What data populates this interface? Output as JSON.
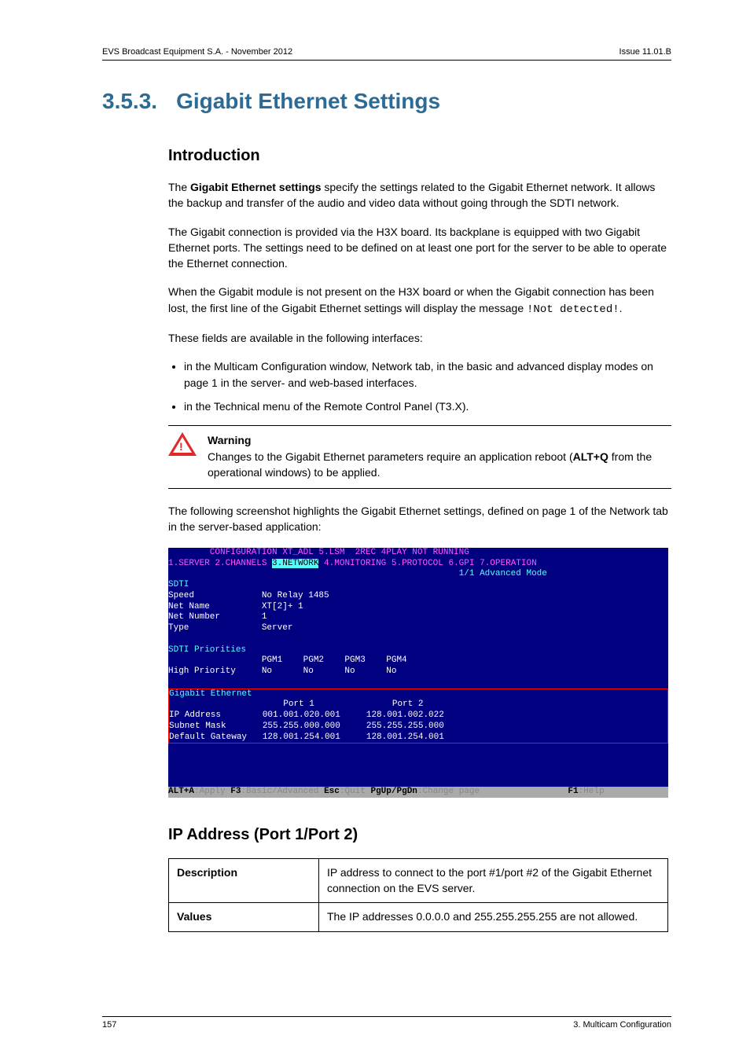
{
  "header": {
    "left": "EVS Broadcast Equipment S.A. - November 2012",
    "right": "Issue 11.01.B"
  },
  "section": {
    "number": "3.5.3.",
    "title": "Gigabit Ethernet Settings"
  },
  "intro": {
    "heading": "Introduction",
    "p1a": "The ",
    "p1b": "Gigabit Ethernet settings",
    "p1c": " specify the settings related to the Gigabit Ethernet network. It allows the backup and transfer of the audio and video data without going through the SDTI network.",
    "p2": "The Gigabit connection is provided via the H3X  board. Its backplane is equipped with two Gigabit Ethernet ports. The settings need to be defined on at least one port for the server to be able to operate the Ethernet connection.",
    "p3a": "When the Gigabit module is not present on the H3X  board or when the Gigabit connection has been lost, the first line of the Gigabit Ethernet settings will display the message ",
    "p3b": "!Not detected!",
    "p3c": ".",
    "p4": "These fields are available in the following interfaces:",
    "li1": "in the Multicam Configuration window, Network tab, in the basic and advanced display modes on page 1 in the server- and web-based interfaces.",
    "li2": "in the Technical menu of the Remote Control Panel (T3.X)."
  },
  "warning": {
    "label": "Warning",
    "text1": "Changes to the Gigabit Ethernet parameters require an application reboot (",
    "bold": "ALT+Q",
    "text2": " from the operational windows) to be applied."
  },
  "beforeShot": "The following screenshot highlights the Gigabit Ethernet settings, defined on page 1 of the Network tab in the server-based application:",
  "dos": {
    "title": "        CONFIGURATION XT_ADL 5.LSM  2REC 4PLAY NOT RUNNING",
    "tabs_left": "1.SERVER 2.CHANNELS ",
    "tabs_sel": "3.NETWORK",
    "tabs_right": " 4.MONITORING 5.PROTOCOL 6.GPI 7.OPERATION",
    "mode": "                                                        1/1 Advanced Mode",
    "sdti_title": "SDTI",
    "speed": "Speed             No Relay 1485",
    "netname": "Net Name          XT[2]+ 1",
    "netnum": "Net Number        1",
    "type": "Type              Server",
    "prio_title": "SDTI Priorities",
    "prio_hdr": "                  PGM1    PGM2    PGM3    PGM4",
    "prio_val": "High Priority     No      No      No      No",
    "ge_title": "Gigabit Ethernet",
    "ge_hdr": "                      Port 1               Port 2",
    "ge_ip": "IP Address        001.001.020.001     128.001.002.022",
    "ge_mask": "Subnet Mask       255.255.000.000     255.255.255.000",
    "ge_gw": "Default Gateway   128.001.254.001     128.001.254.001",
    "bottom_a": "ALT+A",
    "bottom_b": ":Apply ",
    "bottom_c": "F3",
    "bottom_d": ":Basic/Advanced ",
    "bottom_e": "Esc",
    "bottom_f": ":Quit ",
    "bottom_g": "PgUp/PgDn",
    "bottom_h": ":Change page",
    "bottom_i": "                 ",
    "bottom_j": "F1",
    "bottom_k": ":Help"
  },
  "ipsec": {
    "heading": "IP Address (Port 1/Port 2)",
    "descLabel": "Description",
    "descText": "IP address to connect to the port #1/port #2 of the Gigabit Ethernet connection on the EVS server.",
    "valLabel": "Values",
    "valText": "The IP addresses 0.0.0.0 and 255.255.255.255 are not allowed."
  },
  "footer": {
    "left": "157",
    "right": "3. Multicam Configuration"
  }
}
